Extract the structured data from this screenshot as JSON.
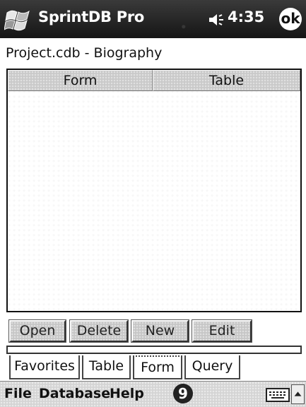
{
  "titlebar": {
    "app_title": "SprintDB Pro",
    "time": "4:35",
    "ok_label": "ok",
    "start_icon": "windows-flag-icon",
    "volume_icon": "speaker-icon"
  },
  "caption": "Project.cdb - Biography",
  "list": {
    "columns": [
      "Form",
      "Table"
    ],
    "rows": []
  },
  "buttons": {
    "open": "Open",
    "delete": "Delete",
    "new": "New",
    "edit": "Edit"
  },
  "tabs": [
    "Favorites",
    "Table",
    "Form",
    "Query"
  ],
  "selected_tab": "Form",
  "menubar": {
    "items": [
      "File",
      "Database",
      "Help"
    ],
    "badge": "9",
    "keyboard_icon": "keyboard-icon",
    "sip_icon": "arrow-up-icon"
  }
}
